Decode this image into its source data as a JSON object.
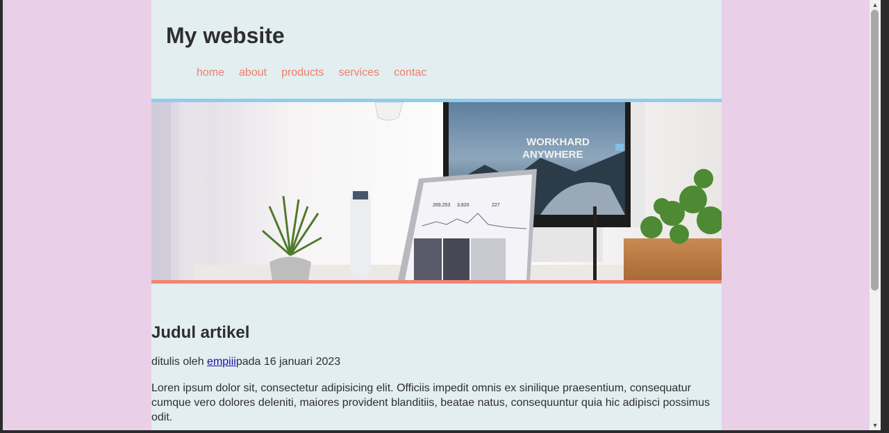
{
  "site": {
    "title": "My website"
  },
  "nav": {
    "items": [
      {
        "label": "home"
      },
      {
        "label": "about"
      },
      {
        "label": "products"
      },
      {
        "label": "services"
      },
      {
        "label": "contac"
      }
    ]
  },
  "banner": {
    "screen_text_line1": "WORKHARD",
    "screen_text_line2": "ANYWHERE",
    "laptop_stats": [
      "269,253",
      "3,820",
      "227"
    ]
  },
  "article": {
    "title": "Judul artikel",
    "byline_prefix": "ditulis oleh ",
    "author": "empiii",
    "byline_suffix": "pada 16 januari 2023",
    "body": "Loren ipsum dolor sit, consectetur adipisicing elit. Officiis impedit omnis ex sinilique praesentium, consequatur cumque vero dolores deleniti, maiores provident blanditiis, beatae natus, consequuntur quia hic adipisci possimus odit."
  },
  "colors": {
    "page_bg": "#eacfe8",
    "content_bg": "#e2eef0",
    "nav_link": "#f07e6a",
    "banner_top_border": "#8fcdee",
    "banner_bottom_border": "#f38472"
  },
  "icons": {
    "scroll_up": "▲",
    "scroll_down": "▼"
  }
}
